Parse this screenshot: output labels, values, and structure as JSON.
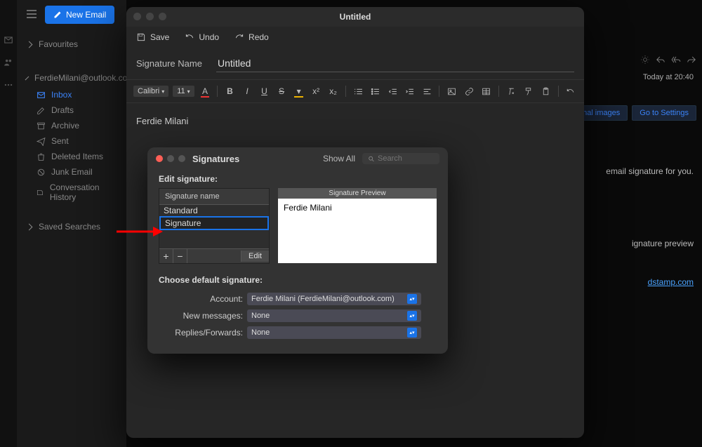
{
  "sidebar": {
    "new_email": "New Email",
    "favourites": "Favourites",
    "account": "FerdieMilani@outlook.co",
    "items": [
      {
        "label": "Inbox",
        "icon": "mail"
      },
      {
        "label": "Drafts",
        "icon": "pencil"
      },
      {
        "label": "Archive",
        "icon": "archive"
      },
      {
        "label": "Sent",
        "icon": "send"
      },
      {
        "label": "Deleted Items",
        "icon": "trash"
      },
      {
        "label": "Junk Email",
        "icon": "block"
      },
      {
        "label": "Conversation History",
        "icon": "folder"
      }
    ],
    "saved_searches": "Saved Searches"
  },
  "bg": {
    "time": "Today at 20:40",
    "pill1": "ad external images",
    "pill2": "Go to Settings",
    "frag1": "email signature for you.",
    "frag2": "ignature preview",
    "frag3_link": "dstamp.com"
  },
  "editor": {
    "title": "Untitled",
    "save": "Save",
    "undo": "Undo",
    "redo": "Redo",
    "sig_name_label": "Signature Name",
    "sig_name_value": "Untitled",
    "font": "Calibri",
    "fontsize": "11",
    "canvas_text": "Ferdie Milani"
  },
  "signatures": {
    "title": "Signatures",
    "show_all": "Show All",
    "search_placeholder": "Search",
    "edit_label": "Edit signature:",
    "list_header": "Signature name",
    "list": [
      "Standard",
      "Signature"
    ],
    "edit_btn": "Edit",
    "preview_header": "Signature Preview",
    "preview_text": "Ferdie Milani",
    "choose_label": "Choose default signature:",
    "account_label": "Account:",
    "account_value": "Ferdie Milani (FerdieMilani@outlook.com)",
    "newmsg_label": "New messages:",
    "newmsg_value": "None",
    "replies_label": "Replies/Forwards:",
    "replies_value": "None"
  }
}
